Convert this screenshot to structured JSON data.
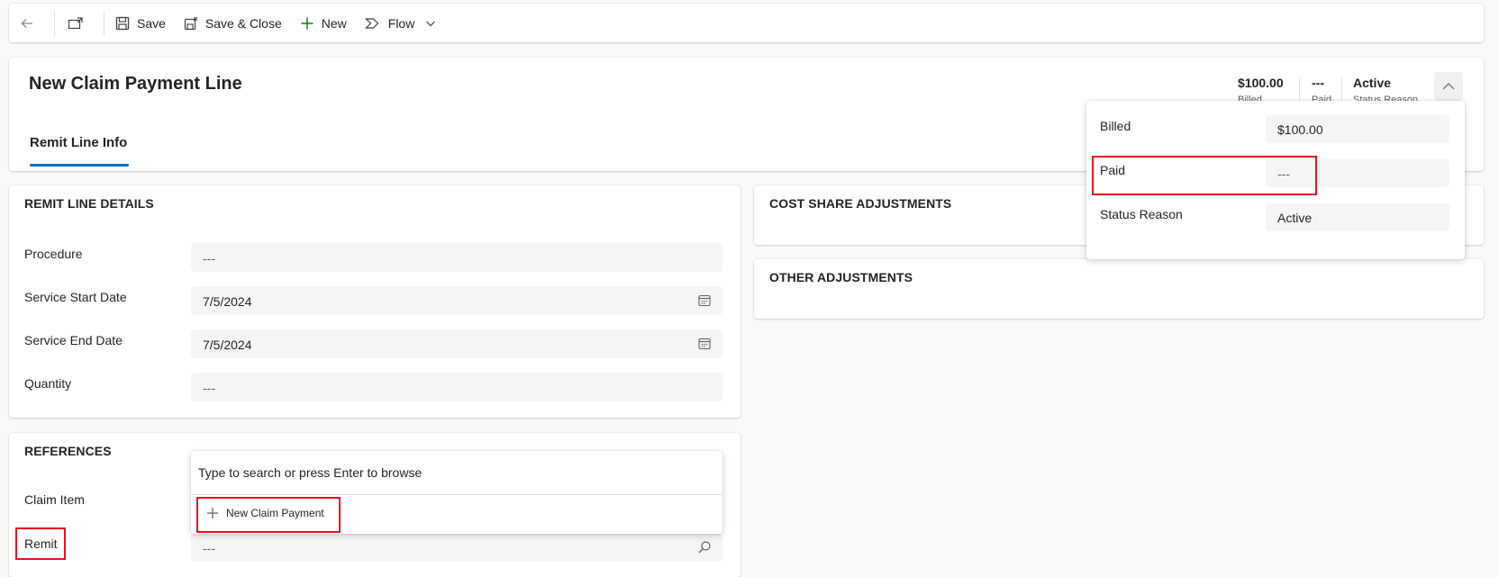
{
  "toolbar": {
    "back_icon": "back-arrow-icon",
    "popout_icon": "popout-icon",
    "save_label": "Save",
    "save_close_label": "Save & Close",
    "new_label": "New",
    "flow_label": "Flow"
  },
  "header": {
    "title": "New Claim Payment Line",
    "fields": [
      {
        "value": "$100.00",
        "label": "Billed"
      },
      {
        "value": "---",
        "label": "Paid"
      },
      {
        "value": "Active",
        "label": "Status Reason"
      }
    ],
    "tabs": [
      {
        "label": "Remit Line Info",
        "selected": true
      }
    ]
  },
  "flyout": {
    "rows": [
      {
        "label": "Billed",
        "value": "$100.00"
      },
      {
        "label": "Paid",
        "value": "---"
      },
      {
        "label": "Status Reason",
        "value": "Active"
      }
    ]
  },
  "sections": {
    "details": {
      "title": "REMIT LINE DETAILS",
      "fields": [
        {
          "label": "Procedure",
          "value": "---"
        },
        {
          "label": "Service Start Date",
          "value": "7/5/2024"
        },
        {
          "label": "Service End Date",
          "value": "7/5/2024"
        },
        {
          "label": "Quantity",
          "value": "---"
        }
      ]
    },
    "cost_share": {
      "title": "COST SHARE ADJUSTMENTS"
    },
    "other": {
      "title": "OTHER ADJUSTMENTS"
    },
    "references": {
      "title": "REFERENCES",
      "fields": [
        {
          "label": "Claim Item"
        },
        {
          "label": "Remit",
          "value": "---"
        }
      ]
    }
  },
  "lookup_dropdown": {
    "hint": "Type to search or press Enter to browse",
    "new_label": "New Claim Payment"
  },
  "colors": {
    "accent": "#0f6cbd",
    "highlight": "#e81123",
    "new_plus": "#107c10"
  }
}
